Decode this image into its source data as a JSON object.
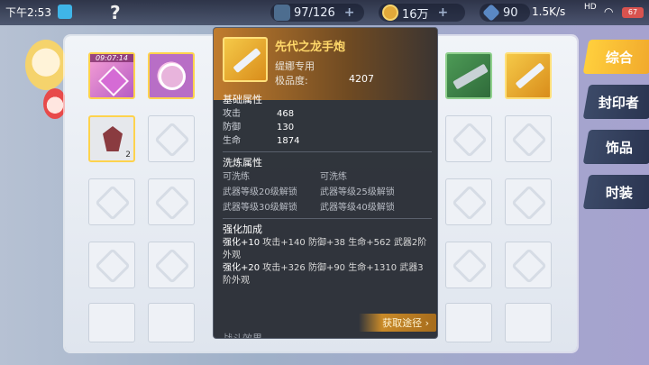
{
  "status": {
    "time": "下午2:53",
    "network_speed": "1.5K/s",
    "signal_label": "HD",
    "battery": "67"
  },
  "resources": {
    "energy": "97/126",
    "gold": "16万",
    "gem": "90"
  },
  "tabs": [
    {
      "label": "综合",
      "active": true
    },
    {
      "label": "封印者",
      "active": false
    },
    {
      "label": "饰品",
      "active": false
    },
    {
      "label": "时装",
      "active": false
    }
  ],
  "inventory": {
    "box_timer": "09:07:14",
    "rock_count": "2"
  },
  "tooltip": {
    "name": "先代之龙手炮",
    "exclusive": "缇娜专用",
    "grade_label": "极品度:",
    "grade_value": "4207",
    "base_title": "基础属性",
    "base": [
      {
        "k": "攻击",
        "v": "468"
      },
      {
        "k": "防御",
        "v": "130"
      },
      {
        "k": "生命",
        "v": "1874"
      }
    ],
    "wash_title": "洗炼属性",
    "wash": [
      "可洗练",
      "可洗练",
      "武器等级20级解锁",
      "武器等级25级解锁",
      "武器等级30级解锁",
      "武器等级40级解锁"
    ],
    "enh_title": "强化加成",
    "enh": [
      {
        "lv": "强化+10",
        "text": "攻击+140 防御+38 生命+562 武器2阶外观"
      },
      {
        "lv": "强化+20",
        "text": "攻击+326 防御+90 生命+1310 武器3阶外观"
      }
    ],
    "more_title": "战斗效果",
    "get_path": "获取途径 ›"
  }
}
